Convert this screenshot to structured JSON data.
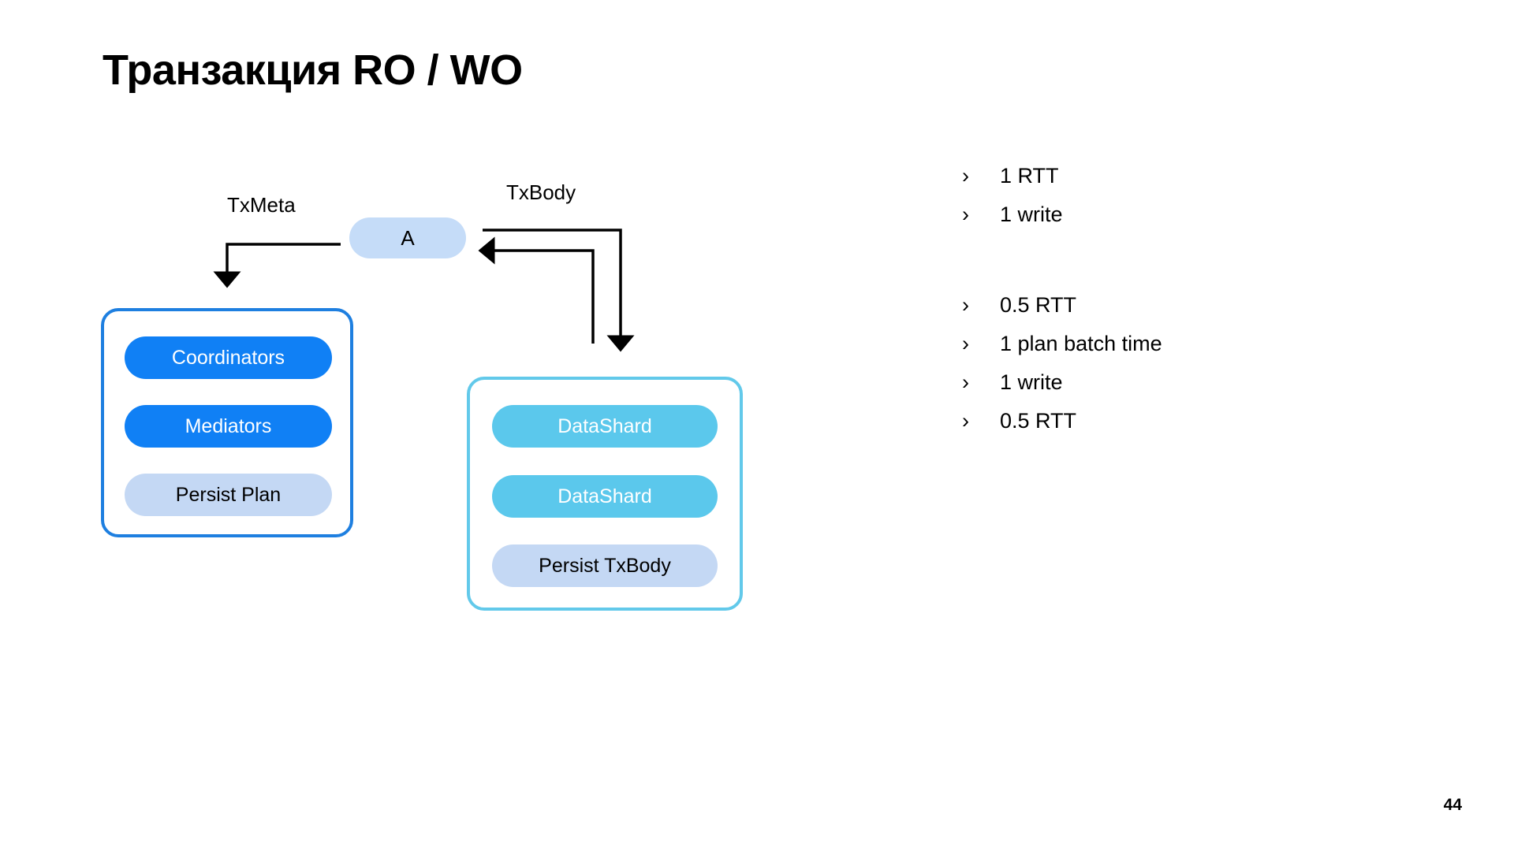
{
  "slide": {
    "title": "Транзакция RO / WO",
    "page_number": "44"
  },
  "diagram": {
    "actor": {
      "label": "A"
    },
    "edges": [
      {
        "name": "txmeta",
        "label": "TxMeta"
      },
      {
        "name": "txbody",
        "label": "TxBody"
      }
    ],
    "groups": [
      {
        "name": "coordinators-group",
        "border_color": "#1E7FE0",
        "items": [
          {
            "label": "Coordinators",
            "fill": "#1080F5",
            "text_color": "#FFFFFF"
          },
          {
            "label": "Mediators",
            "fill": "#1080F5",
            "text_color": "#FFFFFF"
          },
          {
            "label": "Persist Plan",
            "fill": "#C4D8F4",
            "text_color": "#000000"
          }
        ]
      },
      {
        "name": "datashards-group",
        "border_color": "#62C9EA",
        "items": [
          {
            "label": "DataShard",
            "fill": "#5BC8EC",
            "text_color": "#FFFFFF"
          },
          {
            "label": "DataShard",
            "fill": "#5BC8EC",
            "text_color": "#FFFFFF"
          },
          {
            "label": "Persist TxBody",
            "fill": "#C4D8F4",
            "text_color": "#000000"
          }
        ]
      }
    ]
  },
  "notes": {
    "bullet_glyph": "›",
    "groups": [
      {
        "name": "ro-costs",
        "items": [
          {
            "text": "1 RTT"
          },
          {
            "text": "1 write"
          }
        ]
      },
      {
        "name": "wo-costs",
        "items": [
          {
            "text": "0.5 RTT"
          },
          {
            "text": "1 plan batch time"
          },
          {
            "text": "1 write"
          },
          {
            "text": "0.5 RTT"
          }
        ]
      }
    ]
  }
}
